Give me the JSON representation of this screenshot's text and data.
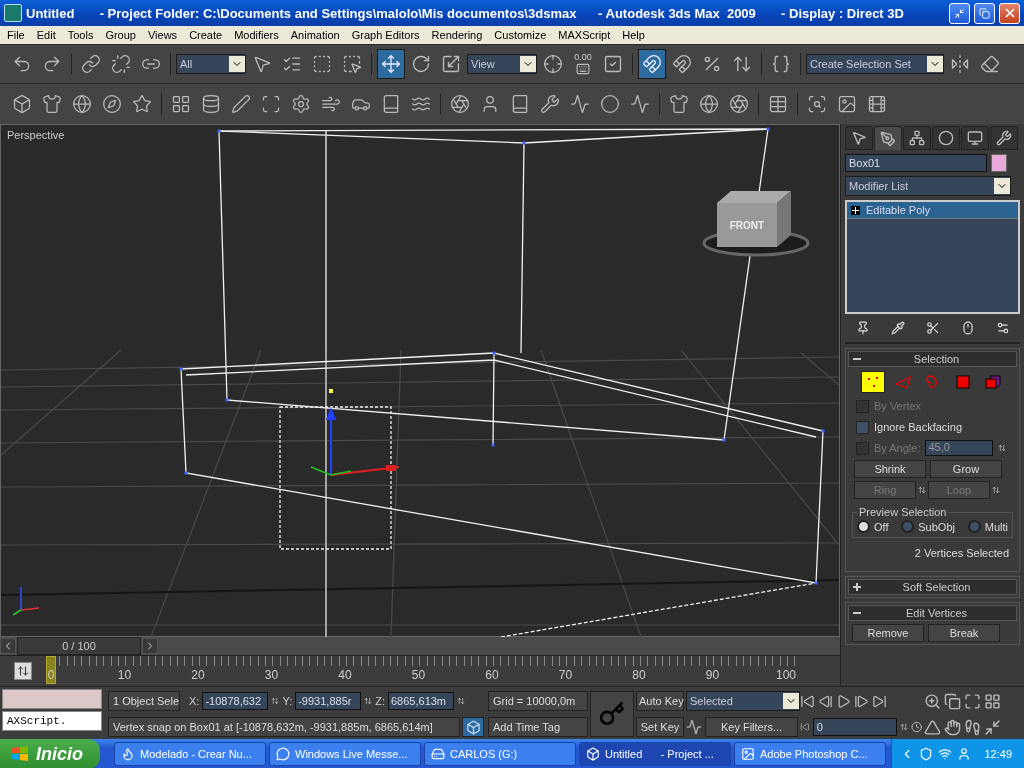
{
  "window": {
    "title": "Untitled       - Project Folder: C:\\Documents and Settings\\malolo\\Mis documentos\\3dsmax      - Autodesk 3ds Max  2009       - Display : Direct 3D"
  },
  "menu": [
    "File",
    "Edit",
    "Tools",
    "Group",
    "Views",
    "Create",
    "Modifiers",
    "Animation",
    "Graph Editors",
    "Rendering",
    "Customize",
    "MAXScript",
    "Help"
  ],
  "main_toolbar": {
    "selection_filter": "All",
    "reference_coord": "View",
    "keyboard_value": "0.00",
    "selection_set_placeholder": "Create Selection Set",
    "buttons": [
      {
        "selected": false
      },
      {
        "selected": false
      },
      {
        "selected": false
      },
      {
        "selected": false
      },
      {
        "selected": false
      },
      {
        "selected": false
      },
      {
        "selected": false
      },
      {
        "selected": false
      },
      {
        "selected": false
      },
      {
        "selected": true
      },
      {
        "selected": false
      },
      {
        "selected": false
      },
      {
        "selected": false
      },
      {
        "selected": false
      },
      {
        "selected": false
      },
      {
        "selected": true
      },
      {
        "selected": false
      },
      {
        "selected": false
      },
      {
        "selected": false
      },
      {
        "selected": false
      },
      {
        "selected": false
      },
      {
        "selected": false
      }
    ]
  },
  "viewport": {
    "label": "Perspective",
    "viewcube_face": "FRONT"
  },
  "command_panel": {
    "tabs": [
      {
        "selected": false
      },
      {
        "selected": true
      },
      {
        "selected": false
      },
      {
        "selected": false
      },
      {
        "selected": false
      },
      {
        "selected": false
      }
    ],
    "object_name": "Box01",
    "modifier_list": "Modifier List",
    "stack": [
      {
        "label": "Editable Poly",
        "selected": true
      }
    ],
    "selection": {
      "title": "Selection",
      "expanded": true,
      "subobjects": [
        {
          "selected": true
        },
        {
          "selected": false
        },
        {
          "selected": false
        },
        {
          "selected": false
        },
        {
          "selected": false
        }
      ],
      "checkboxes": [
        {
          "kind": "check",
          "label": "By Vertex",
          "checked": false,
          "disabled": true
        },
        {
          "kind": "check",
          "label": "Ignore Backfacing",
          "checked": false,
          "disabled": false
        },
        {
          "kind": "spinner",
          "label": "By Angle:",
          "checked": false,
          "disabled": true,
          "value": "45,0"
        }
      ],
      "buttons": [
        {
          "label": "Shrink",
          "disabled": false
        },
        {
          "label": "Grow",
          "disabled": false
        },
        {
          "label": "Ring",
          "disabled": true
        },
        {
          "label": "Loop",
          "disabled": true
        }
      ],
      "preview": {
        "title": "Preview Selection",
        "options": [
          {
            "label": "Off",
            "selected": true
          },
          {
            "label": "SubObj",
            "selected": false
          },
          {
            "label": "Multi",
            "selected": false
          }
        ]
      },
      "status": "2 Vertices Selected"
    },
    "rollouts": [
      {
        "title": "Soft Selection",
        "expanded": false
      },
      {
        "title": "Edit Vertices",
        "expanded": true,
        "buttons": [
          "Remove",
          "Break"
        ]
      }
    ]
  },
  "time_slider": {
    "position": "0 / 100",
    "level": 0
  },
  "track_bar": {
    "labels": [
      "0",
      "10",
      "20",
      "30",
      "40",
      "50",
      "60",
      "70",
      "80",
      "90",
      "100"
    ]
  },
  "status_bar": {
    "listener_value": "AXScript.",
    "selection_info": "1 Object Sele",
    "x_label": "X:",
    "x_value": "-10878,632",
    "y_label": "Y:",
    "y_value": "-9931,885r",
    "z_label": "Z:",
    "z_value": "6865,613m",
    "grid": "Grid = 10000,0m",
    "prompt": "Vertex snap on Box01 at [-10878,632m, -9931,885m, 6865,614m]",
    "time_tag": "Add Time Tag"
  },
  "animation": {
    "auto_key": {
      "label": "Auto Key",
      "on": false
    },
    "key_mode": "Selected",
    "set_key": "Set Key",
    "key_filters": "Key Filters...",
    "frame": "0"
  },
  "taskbar": {
    "start": "Inicio",
    "tasks": [
      {
        "label": "Modelado - Crear Nu...",
        "selected": false
      },
      {
        "label": "Windows Live Messe...",
        "selected": false
      },
      {
        "label": "CARLOS (G:)",
        "selected": false
      },
      {
        "label": "Untitled      - Project ...",
        "selected": true
      },
      {
        "label": "Adobe Photoshop C...",
        "selected": false
      }
    ],
    "clock": "12:49"
  }
}
